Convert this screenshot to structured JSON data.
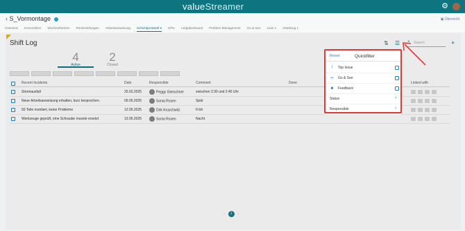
{
  "topbar": {
    "logo_left": "value",
    "logo_right": "Streamer",
    "settings_icon": "gear-icon",
    "avatar_icon": "user-avatar"
  },
  "project": {
    "name": "S_Vormontage",
    "back_arrow": "‹"
  },
  "overview_link": "Übersicht",
  "tabs": [
    {
      "label": "Overview",
      "active": false
    },
    {
      "label": "Kennzahlen",
      "active": false
    },
    {
      "label": "Wochenthemen",
      "active": false
    },
    {
      "label": "Rückmeldungen",
      "active": false
    },
    {
      "label": "Arbeitsanweisung",
      "active": false
    },
    {
      "label": "Schichtprotokoll ▾",
      "active": true
    },
    {
      "label": "KPIs",
      "active": false
    },
    {
      "label": "Aufgabenboard",
      "active": false
    },
    {
      "label": "Problem-Management",
      "active": false
    },
    {
      "label": "Go & See",
      "active": false
    },
    {
      "label": "Linie 1",
      "active": false
    },
    {
      "label": "Abteilung 1",
      "active": false
    }
  ],
  "page": {
    "title": "Shift Log",
    "search_placeholder": "Search",
    "add_label": "+"
  },
  "counters": [
    {
      "value": "4",
      "label": "Active",
      "active": true
    },
    {
      "value": "2",
      "label": "Closed",
      "active": false
    }
  ],
  "table": {
    "headers": [
      "Recent Incidents",
      "Date",
      "Responsible",
      "Comment",
      "Done",
      "Linked with"
    ],
    "rows": [
      {
        "incident": "Stromausfall",
        "date": "25.02.2025",
        "responsible": "Peggy Gierschner",
        "comment": "zwischen 2:30 und 2:45 Uhr"
      },
      {
        "incident": "Neue Arbeitsanweisung erhalten, kurz besprochen.",
        "date": "09.05.2025",
        "responsible": "Sonia Rosen",
        "comment": "Spät"
      },
      {
        "incident": "50 Teile montiert, keine Probleme",
        "date": "12.05.2025",
        "responsible": "Dirk Kruschwitz",
        "comment": "Früh"
      },
      {
        "incident": "Werkzeuge geprüft, eine Schraube musste ersetzt",
        "date": "13.05.2025",
        "responsible": "Sonia Rosen",
        "comment": "Nacht"
      }
    ]
  },
  "pager": {
    "prev": "‹",
    "current": "1",
    "next": "›"
  },
  "quickfilter": {
    "reset": "Reset",
    "title": "Quickfilter",
    "options": [
      {
        "label": "Top Issue",
        "icon": "alert-circle-icon",
        "glyph": "!"
      },
      {
        "label": "Go & See",
        "icon": "glasses-icon",
        "glyph": "∞"
      },
      {
        "label": "Feedback",
        "icon": "feedback-face-icon",
        "glyph": "☻"
      }
    ],
    "expanders": [
      {
        "label": "Status"
      },
      {
        "label": "Responsible"
      }
    ]
  },
  "colors": {
    "brand": "#0e7580",
    "accent": "#1f87c9",
    "highlight_border": "#e03a3a"
  }
}
